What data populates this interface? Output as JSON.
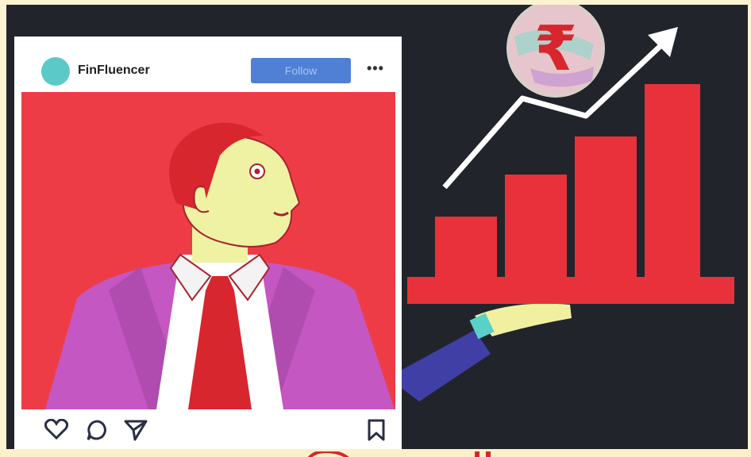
{
  "post": {
    "username": "FinFluencer",
    "follow_label": "Follow",
    "more_label": "•••"
  },
  "icons": {
    "like": "heart-icon",
    "comment": "comment-icon",
    "share": "send-icon",
    "save": "bookmark-icon",
    "coin": "rupee-coin-icon",
    "trend": "trend-up-arrow-icon"
  },
  "colors": {
    "background": "#22242b",
    "post_bg": "#ee3c46",
    "bars": "#e8313a",
    "suit": "#c457c2",
    "follow": "#4f80d6",
    "avatar": "#5cc9c9"
  }
}
